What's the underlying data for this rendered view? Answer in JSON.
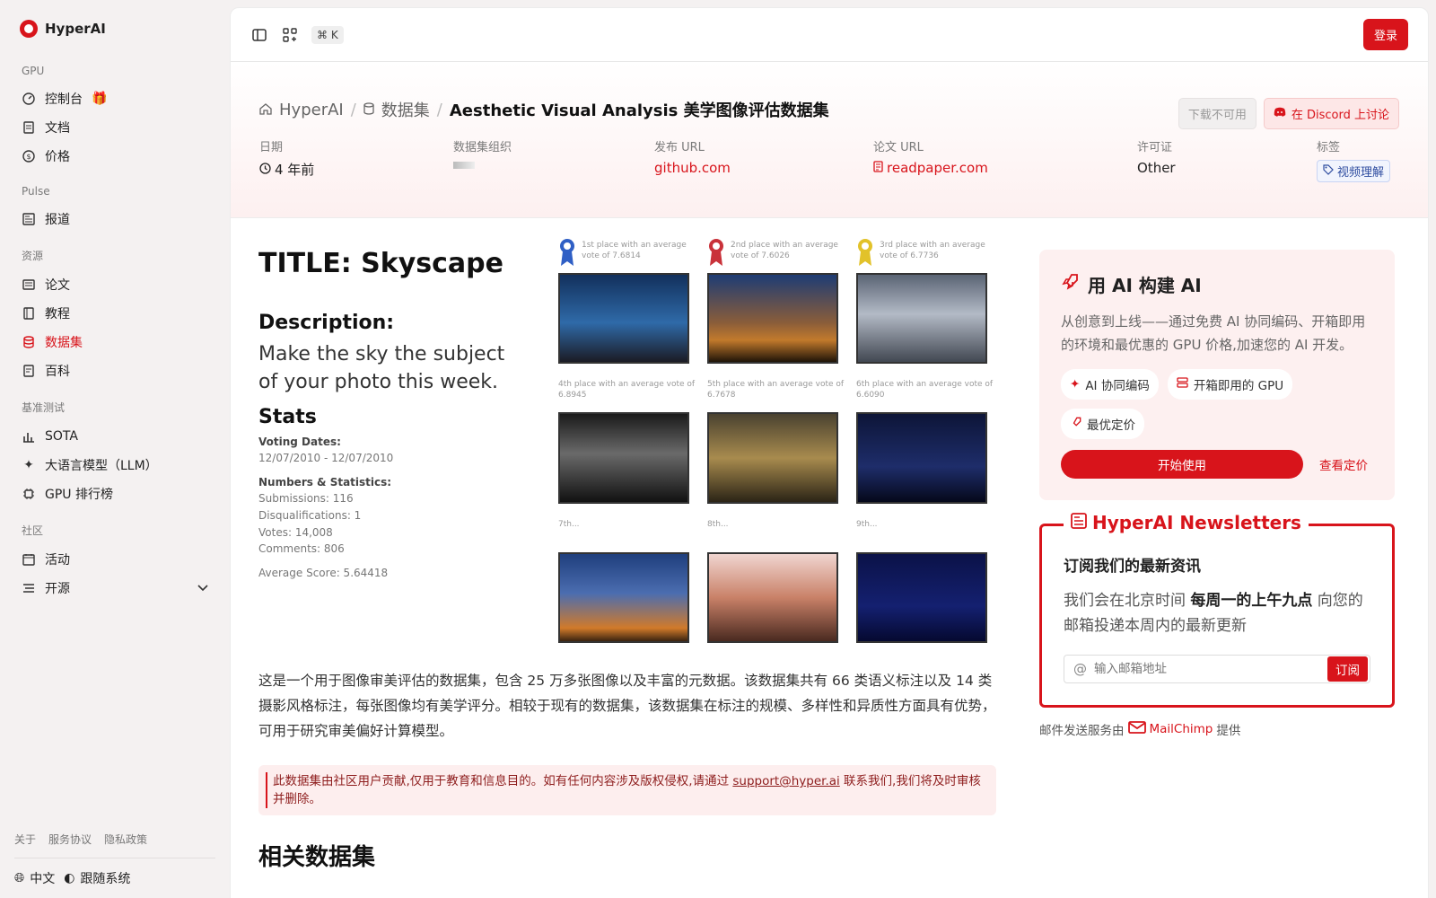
{
  "app": {
    "name": "HyperAI"
  },
  "sidebar": {
    "groups": [
      {
        "label": "GPU",
        "items": [
          {
            "label": "控制台"
          },
          {
            "label": "文档"
          },
          {
            "label": "价格"
          }
        ]
      },
      {
        "label": "Pulse",
        "items": [
          {
            "label": "报道"
          }
        ]
      },
      {
        "label": "资源",
        "items": [
          {
            "label": "论文"
          },
          {
            "label": "教程"
          },
          {
            "label": "数据集"
          },
          {
            "label": "百科"
          }
        ]
      },
      {
        "label": "基准测试",
        "items": [
          {
            "label": "SOTA"
          },
          {
            "label": "大语言模型（LLM）"
          },
          {
            "label": "GPU 排行榜"
          }
        ]
      },
      {
        "label": "社区",
        "items": [
          {
            "label": "活动"
          },
          {
            "label": "开源"
          }
        ]
      }
    ],
    "footer_links": [
      "关于",
      "服务协议",
      "隐私政策"
    ],
    "language": "中文",
    "theme": "跟随系统"
  },
  "topbar": {
    "shortcut": "⌘ K",
    "login": "登录"
  },
  "breadcrumb": {
    "home": "HyperAI",
    "section": "数据集",
    "current": "Aesthetic Visual Analysis 美学图像评估数据集"
  },
  "header_actions": {
    "download": "下载不可用",
    "discord": "在 Discord 上讨论"
  },
  "meta": {
    "date": {
      "label": "日期",
      "value": "4 年前"
    },
    "org": {
      "label": "数据集组织"
    },
    "publish": {
      "label": "发布 URL",
      "value": "github.com"
    },
    "paper": {
      "label": "论文 URL",
      "value": "readpaper.com"
    },
    "license": {
      "label": "许可证",
      "value": "Other"
    },
    "tags": {
      "label": "标签",
      "value": "视频理解"
    }
  },
  "visual": {
    "title": "TITLE: Skyscape",
    "desc_heading": "Description:",
    "desc": "Make the sky the subject of your photo this week.",
    "stats_heading": "Stats",
    "voting_label": "Voting Dates:",
    "voting": "12/07/2010 - 12/07/2010",
    "numbers_label": "Numbers & Statistics:",
    "submissions": "Submissions: 116",
    "disq": "Disqualifications: 1",
    "votes": "Votes: 14,008",
    "comments": "Comments: 806",
    "average": "Average Score: 5.64418",
    "captions": [
      "1st place with an average vote of 7.6814",
      "2nd place with an average vote of 7.6026",
      "3rd place with an average vote of 6.7736",
      "4th place with an average vote of 6.8945",
      "5th place with an average vote of 6.7678",
      "6th place with an average vote of 6.6090",
      "7th...",
      "8th...",
      "9th..."
    ]
  },
  "description": "这是一个用于图像审美评估的数据集，包含 25 万多张图像以及丰富的元数据。该数据集共有 66 类语义标注以及 14 类摄影风格标注，每张图像均有美学评分。相较于现有的数据集，该数据集在标注的规模、多样性和异质性方面具有优势，可用于研究审美偏好计算模型。",
  "notice": {
    "text_before": "此数据集由社区用户贡献,仅用于教育和信息目的。如有任何内容涉及版权侵权,请通过 ",
    "email": "support@hyper.ai",
    "text_after": " 联系我们,我们将及时审核并删除。"
  },
  "related_title": "相关数据集",
  "promo": {
    "title": "用 AI 构建 AI",
    "text": "从创意到上线——通过免费 AI 协同编码、开箱即用的环境和最优惠的 GPU 价格,加速您的 AI 开发。",
    "chips": [
      "AI 协同编码",
      "开箱即用的 GPU",
      "最优定价"
    ],
    "start": "开始使用",
    "pricing": "查看定价"
  },
  "newsletter": {
    "legend": "HyperAI Newsletters",
    "heading": "订阅我们的最新资讯",
    "p_before": "我们会在北京时间 ",
    "p_bold": "每周一的上午九点",
    "p_after": " 向您的邮箱投递本周内的最新更新",
    "placeholder": "输入邮箱地址",
    "subscribe": "订阅",
    "provider_before": "邮件发送服务由",
    "provider": "MailChimp",
    "provider_after": "提供"
  },
  "colors": {
    "brand": "#d8141b"
  }
}
